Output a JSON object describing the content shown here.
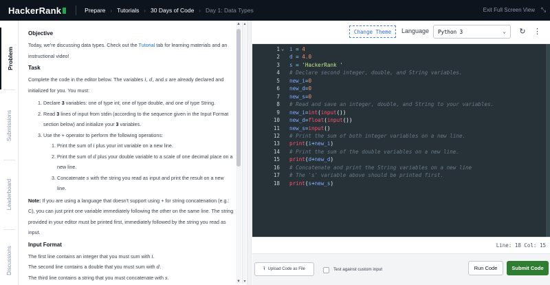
{
  "nav": {
    "logo": "HackerRank",
    "items": [
      "Prepare",
      "Tutorials",
      "30 Days of Code",
      "Day 1: Data Types"
    ],
    "exit_fullscreen": "Exit Full Screen View"
  },
  "side_tabs": [
    "Problem",
    "Submissions",
    "Leaderboard",
    "Discussions"
  ],
  "problem": {
    "objective_title": "Objective",
    "objective_text_1": "Today, we're discussing data types. Check out the",
    "objective_link": "Tutorial",
    "objective_text_2": "tab for learning materials and an instructional video!",
    "task_title": "Task",
    "task_intro_1": "Complete the code in the editor below. The variables",
    "task_intro_vars": "i, d,",
    "task_intro_and": "and",
    "task_intro_s": "s",
    "task_intro_2": "are already declared and initialized for you. You must:",
    "step1_a": "Declare",
    "step1_num": "3",
    "step1_b": "variables: one of type int, one of type double, and one of type String.",
    "step2_a": "Read",
    "step2_num": "3",
    "step2_b": "lines of input from stdin (according to the sequence given in the Input Format section below) and initialize your",
    "step2_num2": "3",
    "step2_c": "variables.",
    "step3_a": "Use the",
    "step3_op": "+",
    "step3_b": "operator to perform the following operations:",
    "sub1_a": "Print the sum of",
    "sub1_var": "i",
    "sub1_b": "plus your int variable on a new line.",
    "sub2_a": "Print the sum of",
    "sub2_var": "d",
    "sub2_b": "plus your double variable to a scale of one decimal place on a new line.",
    "sub3_a": "Concatenate",
    "sub3_var": "s",
    "sub3_b": "with the string you read as input and print the result on a new line.",
    "note_label": "Note:",
    "note_a": "If you are using a language that doesn't support using",
    "note_op": "+",
    "note_b": "for string concatenation (e.g.: C), you can just print one variable immediately following the other on the same line. The string provided in your editor must be printed first, immediately followed by the string you read as input.",
    "input_format_title": "Input Format",
    "if_line1_a": "The first line contains an integer that you must sum with",
    "if_line1_var": "i",
    "if_line2_a": "The second line contains a double that you must sum with",
    "if_line2_var": "d",
    "if_line3_a": "The third line contains a string that you must concatenate with",
    "if_line3_var": "s"
  },
  "toolbar": {
    "change_theme": "Change Theme",
    "language_label": "Language",
    "language_value": "Python 3"
  },
  "editor": {
    "lines": [
      [
        [
          "c-var",
          "i"
        ],
        [
          "c-op",
          " = "
        ],
        [
          "c-num",
          "4"
        ]
      ],
      [
        [
          "c-var",
          "d"
        ],
        [
          "c-op",
          " = "
        ],
        [
          "c-num",
          "4.0"
        ]
      ],
      [
        [
          "c-var",
          "s"
        ],
        [
          "c-op",
          " = "
        ],
        [
          "c-str",
          "'HackerRank '"
        ]
      ],
      [
        [
          "c-com",
          "# Declare second integer, double, and String variables."
        ]
      ],
      [
        [
          "c-var",
          "new_i"
        ],
        [
          "c-op",
          "="
        ],
        [
          "c-num",
          "0"
        ]
      ],
      [
        [
          "c-var",
          "new_d"
        ],
        [
          "c-op",
          "="
        ],
        [
          "c-num",
          "0"
        ]
      ],
      [
        [
          "c-var",
          "new_s"
        ],
        [
          "c-op",
          "="
        ],
        [
          "c-num",
          "0"
        ]
      ],
      [
        [
          "c-com",
          "# Read and save an integer, double, and String to your variables."
        ]
      ],
      [
        [
          "c-var",
          "new_i"
        ],
        [
          "c-op",
          "="
        ],
        [
          "c-fn",
          "int"
        ],
        [
          "c-plain",
          "("
        ],
        [
          "c-fn",
          "input"
        ],
        [
          "c-plain",
          "())"
        ]
      ],
      [
        [
          "c-var",
          "new_d"
        ],
        [
          "c-op",
          "="
        ],
        [
          "c-fn",
          "float"
        ],
        [
          "c-plain",
          "("
        ],
        [
          "c-fn",
          "input"
        ],
        [
          "c-plain",
          "())"
        ]
      ],
      [
        [
          "c-var",
          "new_s"
        ],
        [
          "c-op",
          "="
        ],
        [
          "c-fn",
          "input"
        ],
        [
          "c-plain",
          "()"
        ]
      ],
      [
        [
          "c-com",
          "# Print the sum of both integer variables on a new line."
        ]
      ],
      [
        [
          "c-fn",
          "print"
        ],
        [
          "c-plain",
          "("
        ],
        [
          "c-var",
          "i"
        ],
        [
          "c-op",
          "+"
        ],
        [
          "c-var",
          "new_i"
        ],
        [
          "c-plain",
          ")"
        ]
      ],
      [
        [
          "c-com",
          "# Print the sum of the double variables on a new line."
        ]
      ],
      [
        [
          "c-fn",
          "print"
        ],
        [
          "c-plain",
          "("
        ],
        [
          "c-var",
          "d"
        ],
        [
          "c-op",
          "+"
        ],
        [
          "c-var",
          "new_d"
        ],
        [
          "c-plain",
          ")"
        ]
      ],
      [
        [
          "c-com",
          "# Concatenate and print the String variables on a new line"
        ]
      ],
      [
        [
          "c-com",
          "# The 's' variable above should be printed first."
        ]
      ],
      [
        [
          "c-fn",
          "print"
        ],
        [
          "c-plain",
          "("
        ],
        [
          "c-var",
          "s"
        ],
        [
          "c-op",
          "+"
        ],
        [
          "c-var",
          "new_s"
        ],
        [
          "c-plain",
          ")"
        ]
      ]
    ]
  },
  "status": {
    "position": "Line: 18 Col: 15"
  },
  "actions": {
    "upload": "Upload Code as File",
    "custom_input": "Test against custom input",
    "run": "Run Code",
    "submit": "Submit Code"
  }
}
